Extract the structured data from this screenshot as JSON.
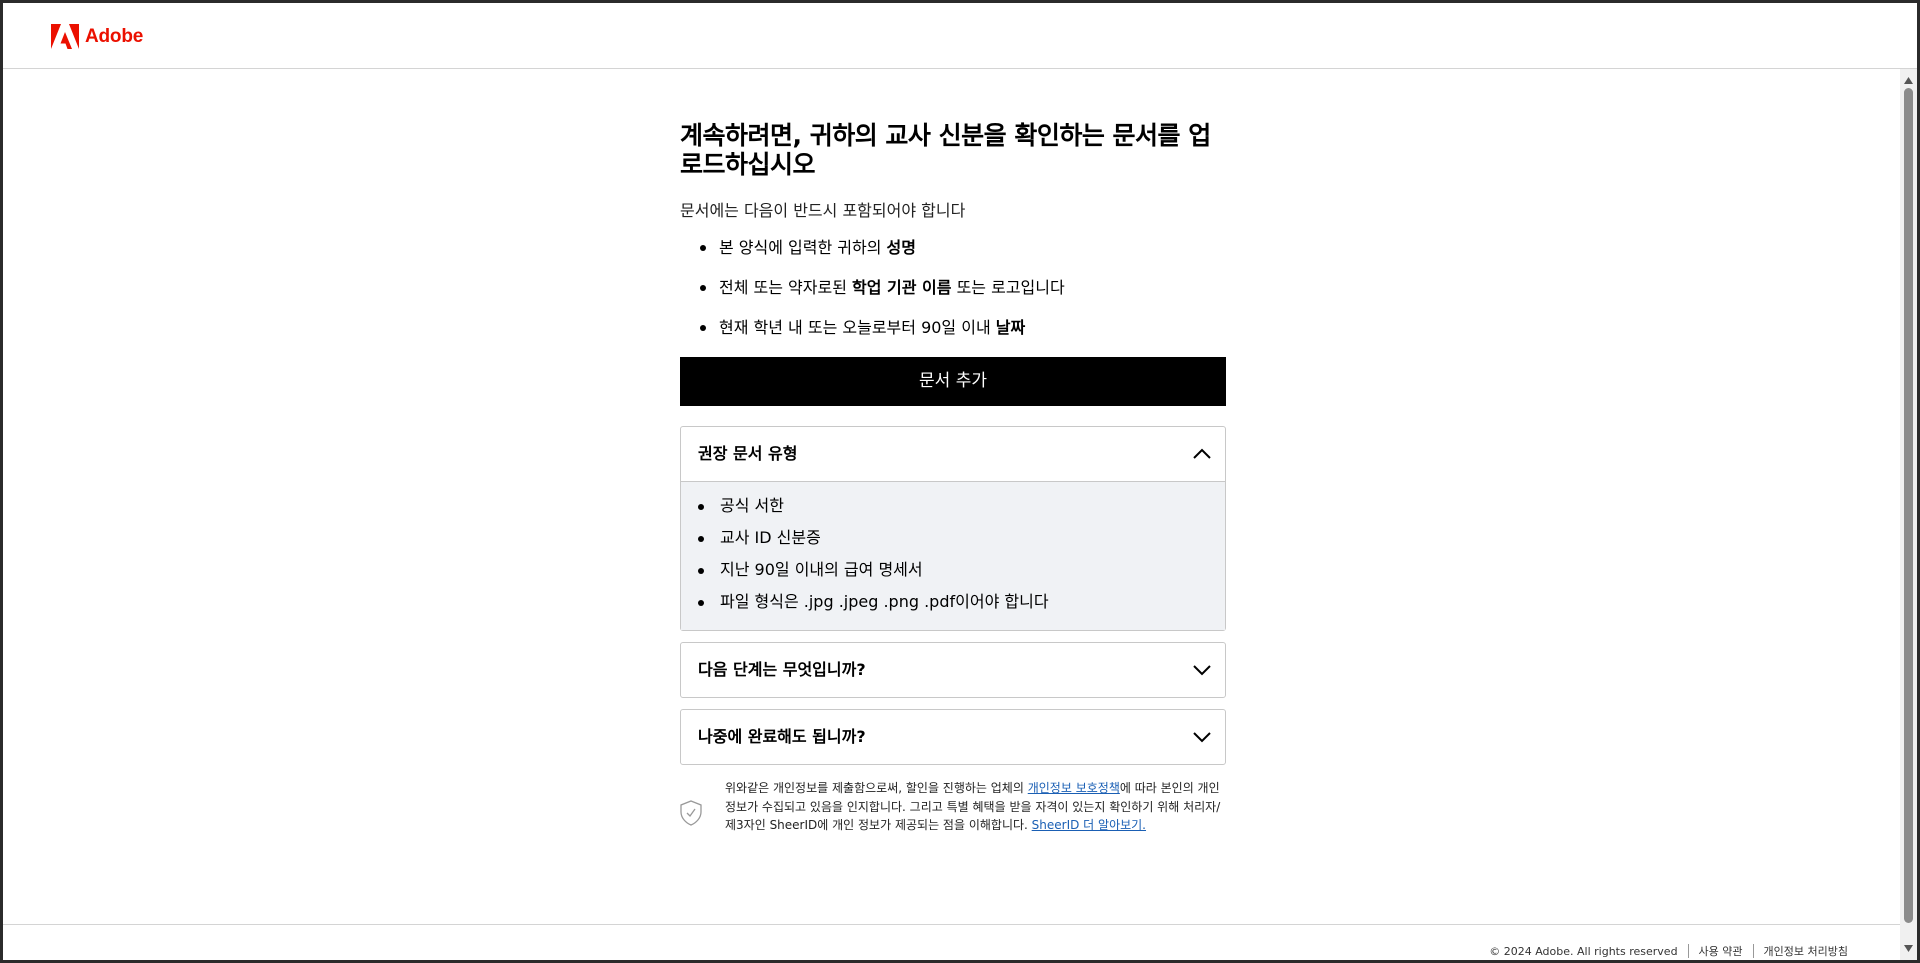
{
  "header": {
    "brand": "Adobe",
    "brand_color": "#eb1000"
  },
  "main": {
    "title": "계속하려면, 귀하의 교사 신분을 확인하는 문서를 업로드하십시오",
    "subtitle": "문서에는 다음이 반드시 포함되어야 합니다",
    "requirements": [
      {
        "pre": "본 양식에 입력한 귀하의 ",
        "bold": "성명",
        "post": ""
      },
      {
        "pre": "전체 또는 약자로된 ",
        "bold": "학업 기관 이름",
        "post": " 또는 로고입니다"
      },
      {
        "pre": "현재 학년 내 또는 오늘로부터 90일 이내 ",
        "bold": "날짜",
        "post": ""
      }
    ],
    "add_button": "문서 추가",
    "accordions": [
      {
        "title": "권장 문서 유형",
        "expanded": true,
        "items": [
          "공식 서한",
          "교사 ID 신분증",
          "지난 90일 이내의 급여 명세서",
          "파일 형식은 .jpg .jpeg .png .pdf이어야 합니다"
        ]
      },
      {
        "title": "다음 단계는 무엇입니까?",
        "expanded": false
      },
      {
        "title": "나중에 완료해도 됩니까?",
        "expanded": false
      }
    ],
    "privacy": {
      "text_1": "위와같은 개인정보를 제출함으로써, 할인을 진행하는 업체의 ",
      "link_1": "개인정보 보호정책",
      "text_2": "에 따라 본인의 개인정보가 수집되고 있음을 인지합니다. 그리고 특별 혜택을 받을 자격이 있는지 확인하기 위해 처리자/제3자인 SheerID에 개인 정보가 제공되는 점을 이해합니다. ",
      "link_2": "SheerID 더 알아보기."
    }
  },
  "footer": {
    "copyright": "© 2024 Adobe. All rights reserved",
    "terms": "사용 약관",
    "privacy_policy": "개인정보 처리방침"
  }
}
